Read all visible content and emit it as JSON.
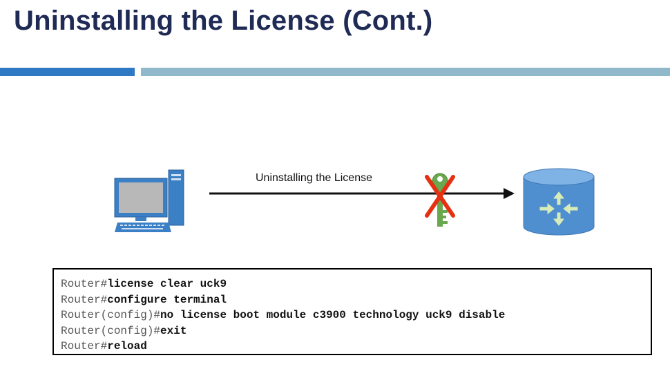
{
  "slide": {
    "title": "Uninstalling the License (Cont.)"
  },
  "diagram": {
    "arrow_label": "Uninstalling the License",
    "icons": [
      "pc-icon",
      "key-icon",
      "x-mark-icon",
      "router-icon"
    ],
    "colors": {
      "title": "#1f2a55",
      "bar_primary": "#2f78c4",
      "bar_secondary": "#8fb8cb",
      "router": "#4f8fd0",
      "key": "#6aa84f",
      "x_mark": "#e53012"
    }
  },
  "commands": [
    {
      "prompt": "Router#",
      "command": "license clear uck9"
    },
    {
      "prompt": "Router#",
      "command": "configure terminal"
    },
    {
      "prompt": "Router(config)#",
      "command": "no license boot module c3900 technology uck9 disable"
    },
    {
      "prompt": "Router(config)#",
      "command": "exit"
    },
    {
      "prompt": "Router#",
      "command": "reload"
    }
  ]
}
